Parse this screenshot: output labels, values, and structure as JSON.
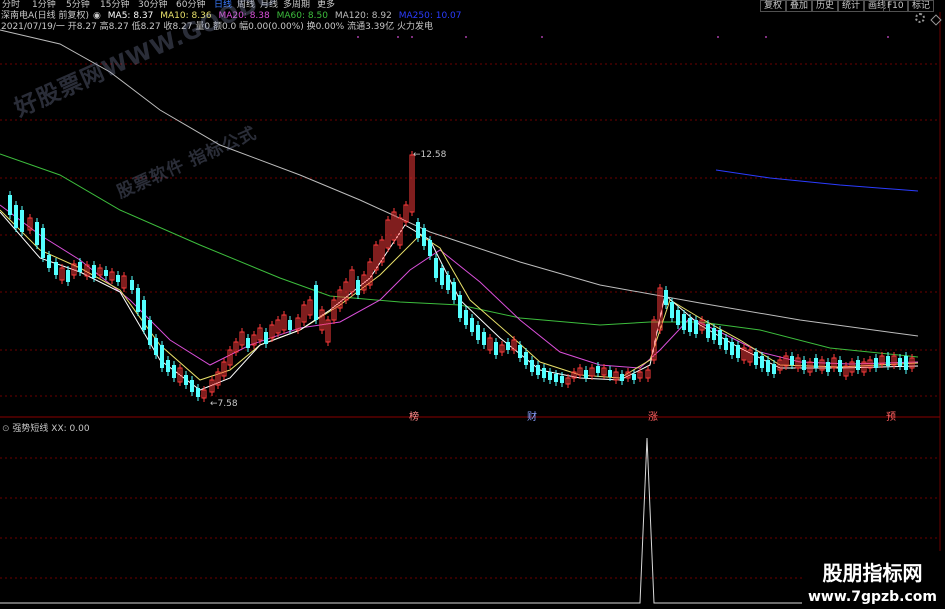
{
  "toolbar": {
    "tabs": [
      "分时",
      "1分钟",
      "5分钟",
      "15分钟",
      "30分钟",
      "60分钟",
      "日线",
      "周线",
      "月线",
      "多周期",
      "更多"
    ],
    "active_tab": "日线",
    "right_buttons": [
      "复权",
      "叠加",
      "历史",
      "统计",
      "画线",
      "F10",
      "标记"
    ],
    "settings_icon": "gear-icon",
    "diamond_icon": "diamond-icon"
  },
  "info_line1": {
    "stock": "深南电A(日线 前复权)",
    "ma5": "MA5: 8.37",
    "ma10": "MA10: 8.36",
    "ma20": "MA20: 8.38",
    "ma60": "MA60: 8.50",
    "ma120": "MA120: 8.92",
    "ma250": "MA250: 10.07"
  },
  "info_line2": {
    "text": "2021/07/19/一 开8.27 高8.27 低8.27 收8.27 量0 额0.0 幅0.00(0.00%) 换0.00% 流通3.39亿 火力发电"
  },
  "labels": {
    "high": "12.58",
    "low": "7.58"
  },
  "signals": [
    "榜",
    "财",
    "涨",
    "预"
  ],
  "indicator": {
    "title": "强势短线 XX: 0.00"
  },
  "watermark": {
    "line1": "好股票网WWW.GOODGUPIAO.COM",
    "line2": "股票软件 指标公式"
  },
  "site_logo": {
    "line1": "股朋指标网",
    "line2": "www.7gpzb.com"
  },
  "colors": {
    "up": "#ff3b3b",
    "down": "#54ffff",
    "ma5": "#ffffff",
    "ma10": "#e8e06a",
    "ma20": "#d94fd9",
    "ma60": "#3dbd3d",
    "ma120": "#bdbdbd",
    "ma250": "#2b3cff"
  }
}
